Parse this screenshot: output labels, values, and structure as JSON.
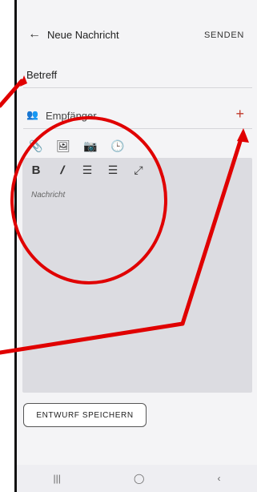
{
  "header": {
    "back_icon": "←",
    "title": "Neue Nachricht",
    "send_label": "SENDEN"
  },
  "form": {
    "subject_placeholder": "Betreff",
    "recipients_label": "Empfänger",
    "add_icon": "+"
  },
  "editor": {
    "placeholder": "Nachricht"
  },
  "toolbar": {
    "attach_icon": "📎",
    "image_icon": "🖼",
    "camera_icon": "📷",
    "clock_icon": "🕒",
    "bold_icon": "B",
    "italic_icon": "𝐼",
    "ordered_list_icon": "☰",
    "unordered_list_icon": "☰",
    "fullscreen_icon": "⤢"
  },
  "actions": {
    "save_draft": "ENTWURF SPEICHERN"
  },
  "navbar": {
    "recent": "|||",
    "home": "◯",
    "back": "‹"
  },
  "annotation": {
    "color": "#e00000"
  }
}
